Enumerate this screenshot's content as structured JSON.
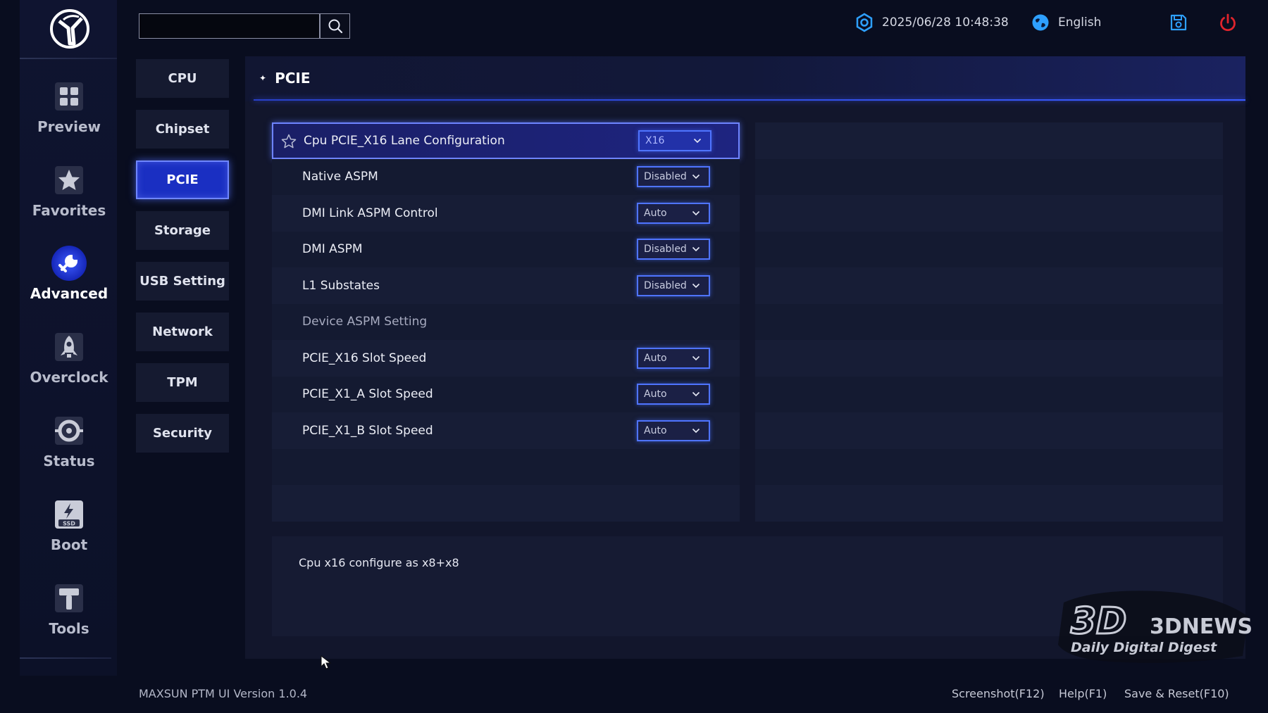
{
  "topbar": {
    "search_placeholder": "",
    "datetime": "2025/06/28 10:48:38",
    "language": "English"
  },
  "nav": [
    {
      "label": "Preview",
      "icon": "preview-icon"
    },
    {
      "label": "Favorites",
      "icon": "favorites-star-icon"
    },
    {
      "label": "Advanced",
      "icon": "advanced-wrench-icon",
      "active": true
    },
    {
      "label": "Overclock",
      "icon": "overclock-rocket-icon"
    },
    {
      "label": "Status",
      "icon": "status-gauge-icon"
    },
    {
      "label": "Boot",
      "icon": "boot-ssd-icon"
    },
    {
      "label": "Tools",
      "icon": "tools-hammer-icon"
    }
  ],
  "categories": [
    {
      "label": "CPU"
    },
    {
      "label": "Chipset"
    },
    {
      "label": "PCIE",
      "active": true
    },
    {
      "label": "Storage"
    },
    {
      "label": "USB Setting"
    },
    {
      "label": "Network"
    },
    {
      "label": "TPM"
    },
    {
      "label": "Security"
    }
  ],
  "section": {
    "title": "PCIE"
  },
  "settings": [
    {
      "label": "Cpu PCIE_X16 Lane Configuration",
      "value": "X16",
      "selected": true
    },
    {
      "label": "Native ASPM",
      "value": "Disabled"
    },
    {
      "label": "DMI Link ASPM Control",
      "value": "Auto"
    },
    {
      "label": "DMI ASPM",
      "value": "Disabled"
    },
    {
      "label": "L1 Substates",
      "value": "Disabled"
    },
    {
      "label": "Device ASPM Setting",
      "value": null,
      "subheading": true
    },
    {
      "label": "PCIE_X16 Slot Speed",
      "value": "Auto"
    },
    {
      "label": "PCIE_X1_A Slot Speed",
      "value": "Auto"
    },
    {
      "label": "PCIE_X1_B Slot Speed",
      "value": "Auto"
    }
  ],
  "help": {
    "text": "Cpu x16 configure as x8+x8"
  },
  "footer": {
    "version": "MAXSUN PTM UI Version 1.0.4",
    "screenshot": "Screenshot(F12)",
    "help": "Help(F1)",
    "save_reset": "Save & Reset(F10)"
  },
  "watermark": {
    "brand": "3DNEWS",
    "tagline": "Daily Digital Digest"
  },
  "colors": {
    "accent": "#1a2fc2",
    "accent_border": "#6f86ff",
    "background": "#090d1f",
    "power": "#e0242c",
    "topbar_icon": "#2ea0ff"
  }
}
